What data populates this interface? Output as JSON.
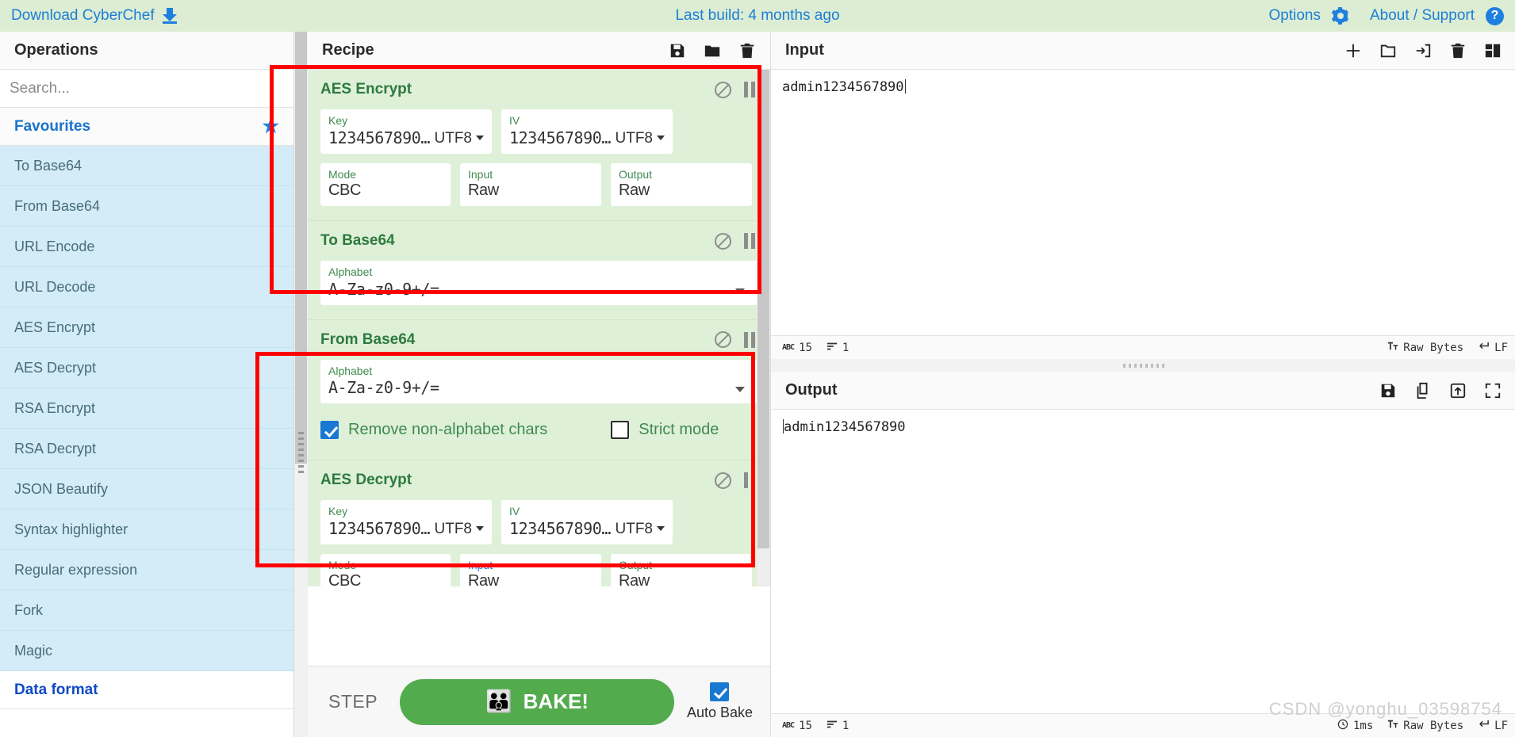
{
  "banner": {
    "download_label": "Download CyberChef",
    "download_icon": "download-icon",
    "last_build": "Last build: 4 months ago",
    "options_label": "Options",
    "options_icon": "gear-icon",
    "about_label": "About / Support",
    "about_icon": "question-circle-icon"
  },
  "operations": {
    "title": "Operations",
    "search_placeholder": "Search...",
    "search_value": "",
    "categories": [
      {
        "label": "Favourites",
        "icon": "star-icon",
        "expanded": true
      },
      {
        "label": "Data format",
        "icon": "",
        "expanded": false
      }
    ],
    "items": [
      {
        "label": "To Base64"
      },
      {
        "label": "From Base64"
      },
      {
        "label": "URL Encode"
      },
      {
        "label": "URL Decode"
      },
      {
        "label": "AES Encrypt"
      },
      {
        "label": "AES Decrypt"
      },
      {
        "label": "RSA Encrypt"
      },
      {
        "label": "RSA Decrypt"
      },
      {
        "label": "JSON Beautify"
      },
      {
        "label": "Syntax highlighter"
      },
      {
        "label": "Regular expression"
      },
      {
        "label": "Fork"
      },
      {
        "label": "Magic"
      }
    ]
  },
  "recipe": {
    "title": "Recipe",
    "icons": [
      {
        "name": "save-icon"
      },
      {
        "name": "folder-icon"
      },
      {
        "name": "trash-icon"
      }
    ],
    "ops": [
      {
        "name": "AES Encrypt",
        "disable_icon": "disable-icon",
        "pause_icon": "pause-icon",
        "fields": {
          "key_label": "Key",
          "key_value": "1234567890…",
          "key_enc": "UTF8",
          "iv_label": "IV",
          "iv_value": "1234567890…",
          "iv_enc": "UTF8",
          "mode_label": "Mode",
          "mode_value": "CBC",
          "input_label": "Input",
          "input_value": "Raw",
          "output_label": "Output",
          "output_value": "Raw"
        }
      },
      {
        "name": "To Base64",
        "alphabet_label": "Alphabet",
        "alphabet_value": "A-Za-z0-9+/="
      },
      {
        "name": "From Base64",
        "alphabet_label": "Alphabet",
        "alphabet_value": "A-Za-z0-9+/=",
        "remove_label": "Remove non-alphabet chars",
        "remove_checked": true,
        "strict_label": "Strict mode",
        "strict_checked": false
      },
      {
        "name": "AES Decrypt",
        "fields": {
          "key_label": "Key",
          "key_value": "1234567890…",
          "key_enc": "UTF8",
          "iv_label": "IV",
          "iv_value": "1234567890…",
          "iv_enc": "UTF8",
          "mode_label": "Mode",
          "mode_value": "CBC",
          "input_label": "Input",
          "input_value": "Raw",
          "output_label": "Output",
          "output_value": "Raw"
        }
      }
    ],
    "bake": {
      "step_label": "STEP",
      "bake_label": "BAKE!",
      "chef_icon": "chef-icon",
      "auto_bake_label": "Auto Bake",
      "auto_bake_checked": true
    }
  },
  "input": {
    "title": "Input",
    "icons": [
      {
        "name": "plus-icon"
      },
      {
        "name": "folder-open-icon"
      },
      {
        "name": "import-icon"
      },
      {
        "name": "trash-icon"
      },
      {
        "name": "layout-icon"
      }
    ],
    "value": "admin1234567890",
    "status": {
      "length_icon": "abc-icon",
      "length": "15",
      "lines_icon": "lines-icon",
      "lines": "1",
      "encoding_icon": "font-icon",
      "encoding": "Raw Bytes",
      "lineending_icon": "enter-icon",
      "lineending": "LF"
    }
  },
  "output": {
    "title": "Output",
    "icons": [
      {
        "name": "save-icon"
      },
      {
        "name": "copy-icon"
      },
      {
        "name": "replace-input-icon"
      },
      {
        "name": "maximise-icon"
      }
    ],
    "value": "admin1234567890",
    "status": {
      "length_icon": "abc-icon",
      "length": "15",
      "lines_icon": "lines-icon",
      "lines": "1",
      "time_icon": "clock-icon",
      "time": "1ms",
      "encoding_icon": "font-icon",
      "encoding": "Raw Bytes",
      "lineending_icon": "enter-icon",
      "lineending": "LF"
    }
  },
  "watermark": "CSDN @yonghu_03598754",
  "colors": {
    "banner_bg": "#dcedd3",
    "link_blue": "#1f7fe0",
    "recipe_green": "#dff0d8",
    "op_name_green": "#2d7a3e",
    "bake_green": "#52ab4d",
    "fav_blue": "#d3ecf7",
    "annotation_red": "#ff0000",
    "checkbox_blue": "#1878d2"
  }
}
